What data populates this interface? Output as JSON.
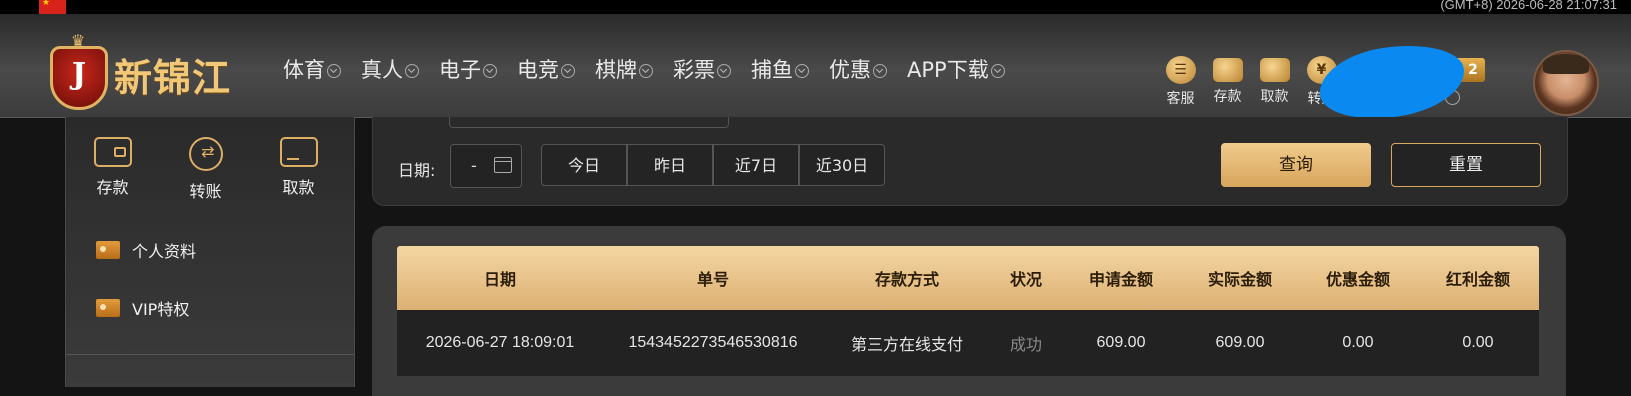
{
  "top": {
    "clock": "(GMT+8) 2026-06-28 21:07:31",
    "flag_icon": "china-flag-icon"
  },
  "brand": {
    "logo_letter": "J",
    "name": "新锦江"
  },
  "nav": [
    {
      "label": "体育"
    },
    {
      "label": "真人"
    },
    {
      "label": "电子"
    },
    {
      "label": "电竞"
    },
    {
      "label": "棋牌"
    },
    {
      "label": "彩票"
    },
    {
      "label": "捕鱼"
    },
    {
      "label": "优惠"
    },
    {
      "label": "APP下载"
    }
  ],
  "tools": [
    {
      "label": "客服",
      "icon": "chat-icon",
      "glyph": "☰"
    },
    {
      "label": "存款",
      "icon": "wallet-icon",
      "glyph": ""
    },
    {
      "label": "取款",
      "icon": "safe-icon",
      "glyph": ""
    },
    {
      "label": "转账",
      "icon": "yen-coin-icon",
      "glyph": "¥"
    }
  ],
  "vip": {
    "badge": "P 2"
  },
  "sidebar": {
    "quick_actions": [
      {
        "label": "存款"
      },
      {
        "label": "转账"
      },
      {
        "label": "取款"
      }
    ],
    "menu": [
      {
        "label": "个人资料"
      },
      {
        "label": "VIP特权"
      }
    ]
  },
  "filter": {
    "date_label": "日期:",
    "date_value": "-",
    "quick_dates": [
      {
        "label": "今日"
      },
      {
        "label": "昨日"
      },
      {
        "label": "近7日"
      },
      {
        "label": "近30日"
      }
    ],
    "query_label": "查询",
    "reset_label": "重置"
  },
  "table": {
    "headers": [
      "日期",
      "单号",
      "存款方式",
      "状况",
      "申请金额",
      "实际金额",
      "优惠金额",
      "红利金额"
    ],
    "rows": [
      [
        "2026-06-27 18:09:01",
        "1543452273546530816",
        "第三方在线支付",
        "成功",
        "609.00",
        "609.00",
        "0.00",
        "0.00"
      ]
    ]
  },
  "colors": {
    "accent_gold": "#dcb073",
    "redaction_blue": "#0a8af0",
    "header_bg": "#3c3c3c"
  }
}
